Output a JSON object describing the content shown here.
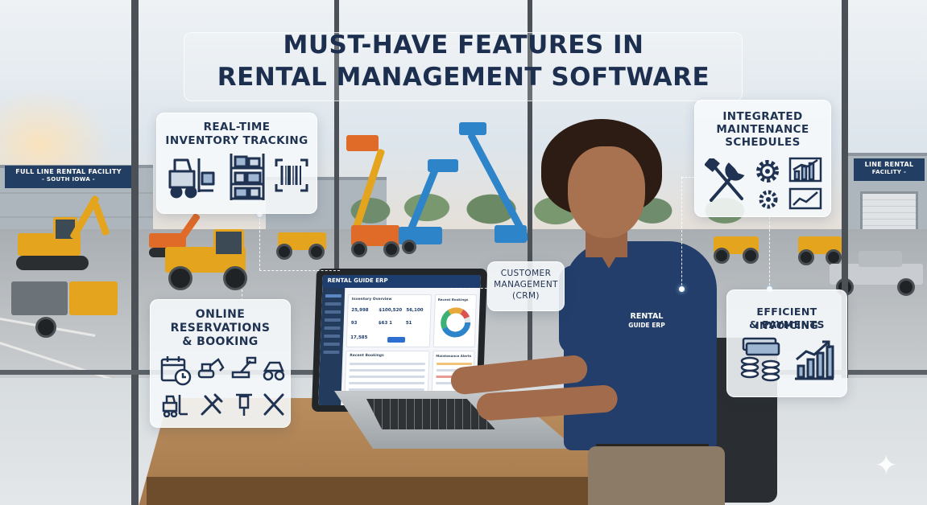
{
  "title": {
    "line1": "MUST-HAVE FEATURES IN",
    "line2": "RENTAL MANAGEMENT SOFTWARE"
  },
  "signs": {
    "left": {
      "line1": "FULL LINE RENTAL FACILITY",
      "line2": "- SOUTH IOWA -"
    },
    "right": {
      "line1": "LINE RENTAL",
      "line2": "FACILITY -"
    }
  },
  "cards": {
    "inventory": {
      "line1": "REAL-TIME",
      "line2": "INVENTORY TRACKING",
      "icons": [
        "forklift-icon",
        "shelving-icon",
        "barcode-icon"
      ]
    },
    "maintenance": {
      "line1": "INTEGRATED",
      "line2": "MAINTENANCE",
      "line3": "SCHEDULES",
      "icons": [
        "wrench-screwdriver-icon",
        "gear-icon",
        "chart-icon"
      ]
    },
    "reservations": {
      "line1": "ONLINE",
      "line2": "RESERVATIONS",
      "line3": "& BOOKING",
      "icons": [
        "calendar-clock-icon",
        "excavator-icon",
        "boom-lift-icon",
        "compactor-icon",
        "forklift-icon",
        "tools-icon",
        "jackhammer-icon",
        "cross-tools-icon"
      ]
    },
    "crm": {
      "line1": "CUSTOMER",
      "line2": "MANAGEMENT",
      "line3": "(CRM)"
    },
    "invoicing": {
      "line1": "EFFICIENT INVOICING",
      "line2": "& PAYMENTS",
      "icons": [
        "money-stack-icon",
        "growth-chart-icon"
      ]
    }
  },
  "laptop": {
    "brand": "RENTAL GUIDE ERP",
    "panels": {
      "inventory_overview": "Inventory Overview",
      "recent_bookings": "Recent Bookings",
      "maintenance_alerts": "Maintenance Alerts"
    },
    "stats": [
      "25,998",
      "$100,520",
      "56,100",
      "93",
      "$63 1",
      "51",
      "17,585"
    ]
  },
  "shirt": {
    "line1": "RENTAL",
    "line2": "GUIDE ERP"
  },
  "colors": {
    "navy": "#1d2f4f",
    "accent_blue": "#2d84c9",
    "equipment_yellow": "#e4a41e"
  }
}
